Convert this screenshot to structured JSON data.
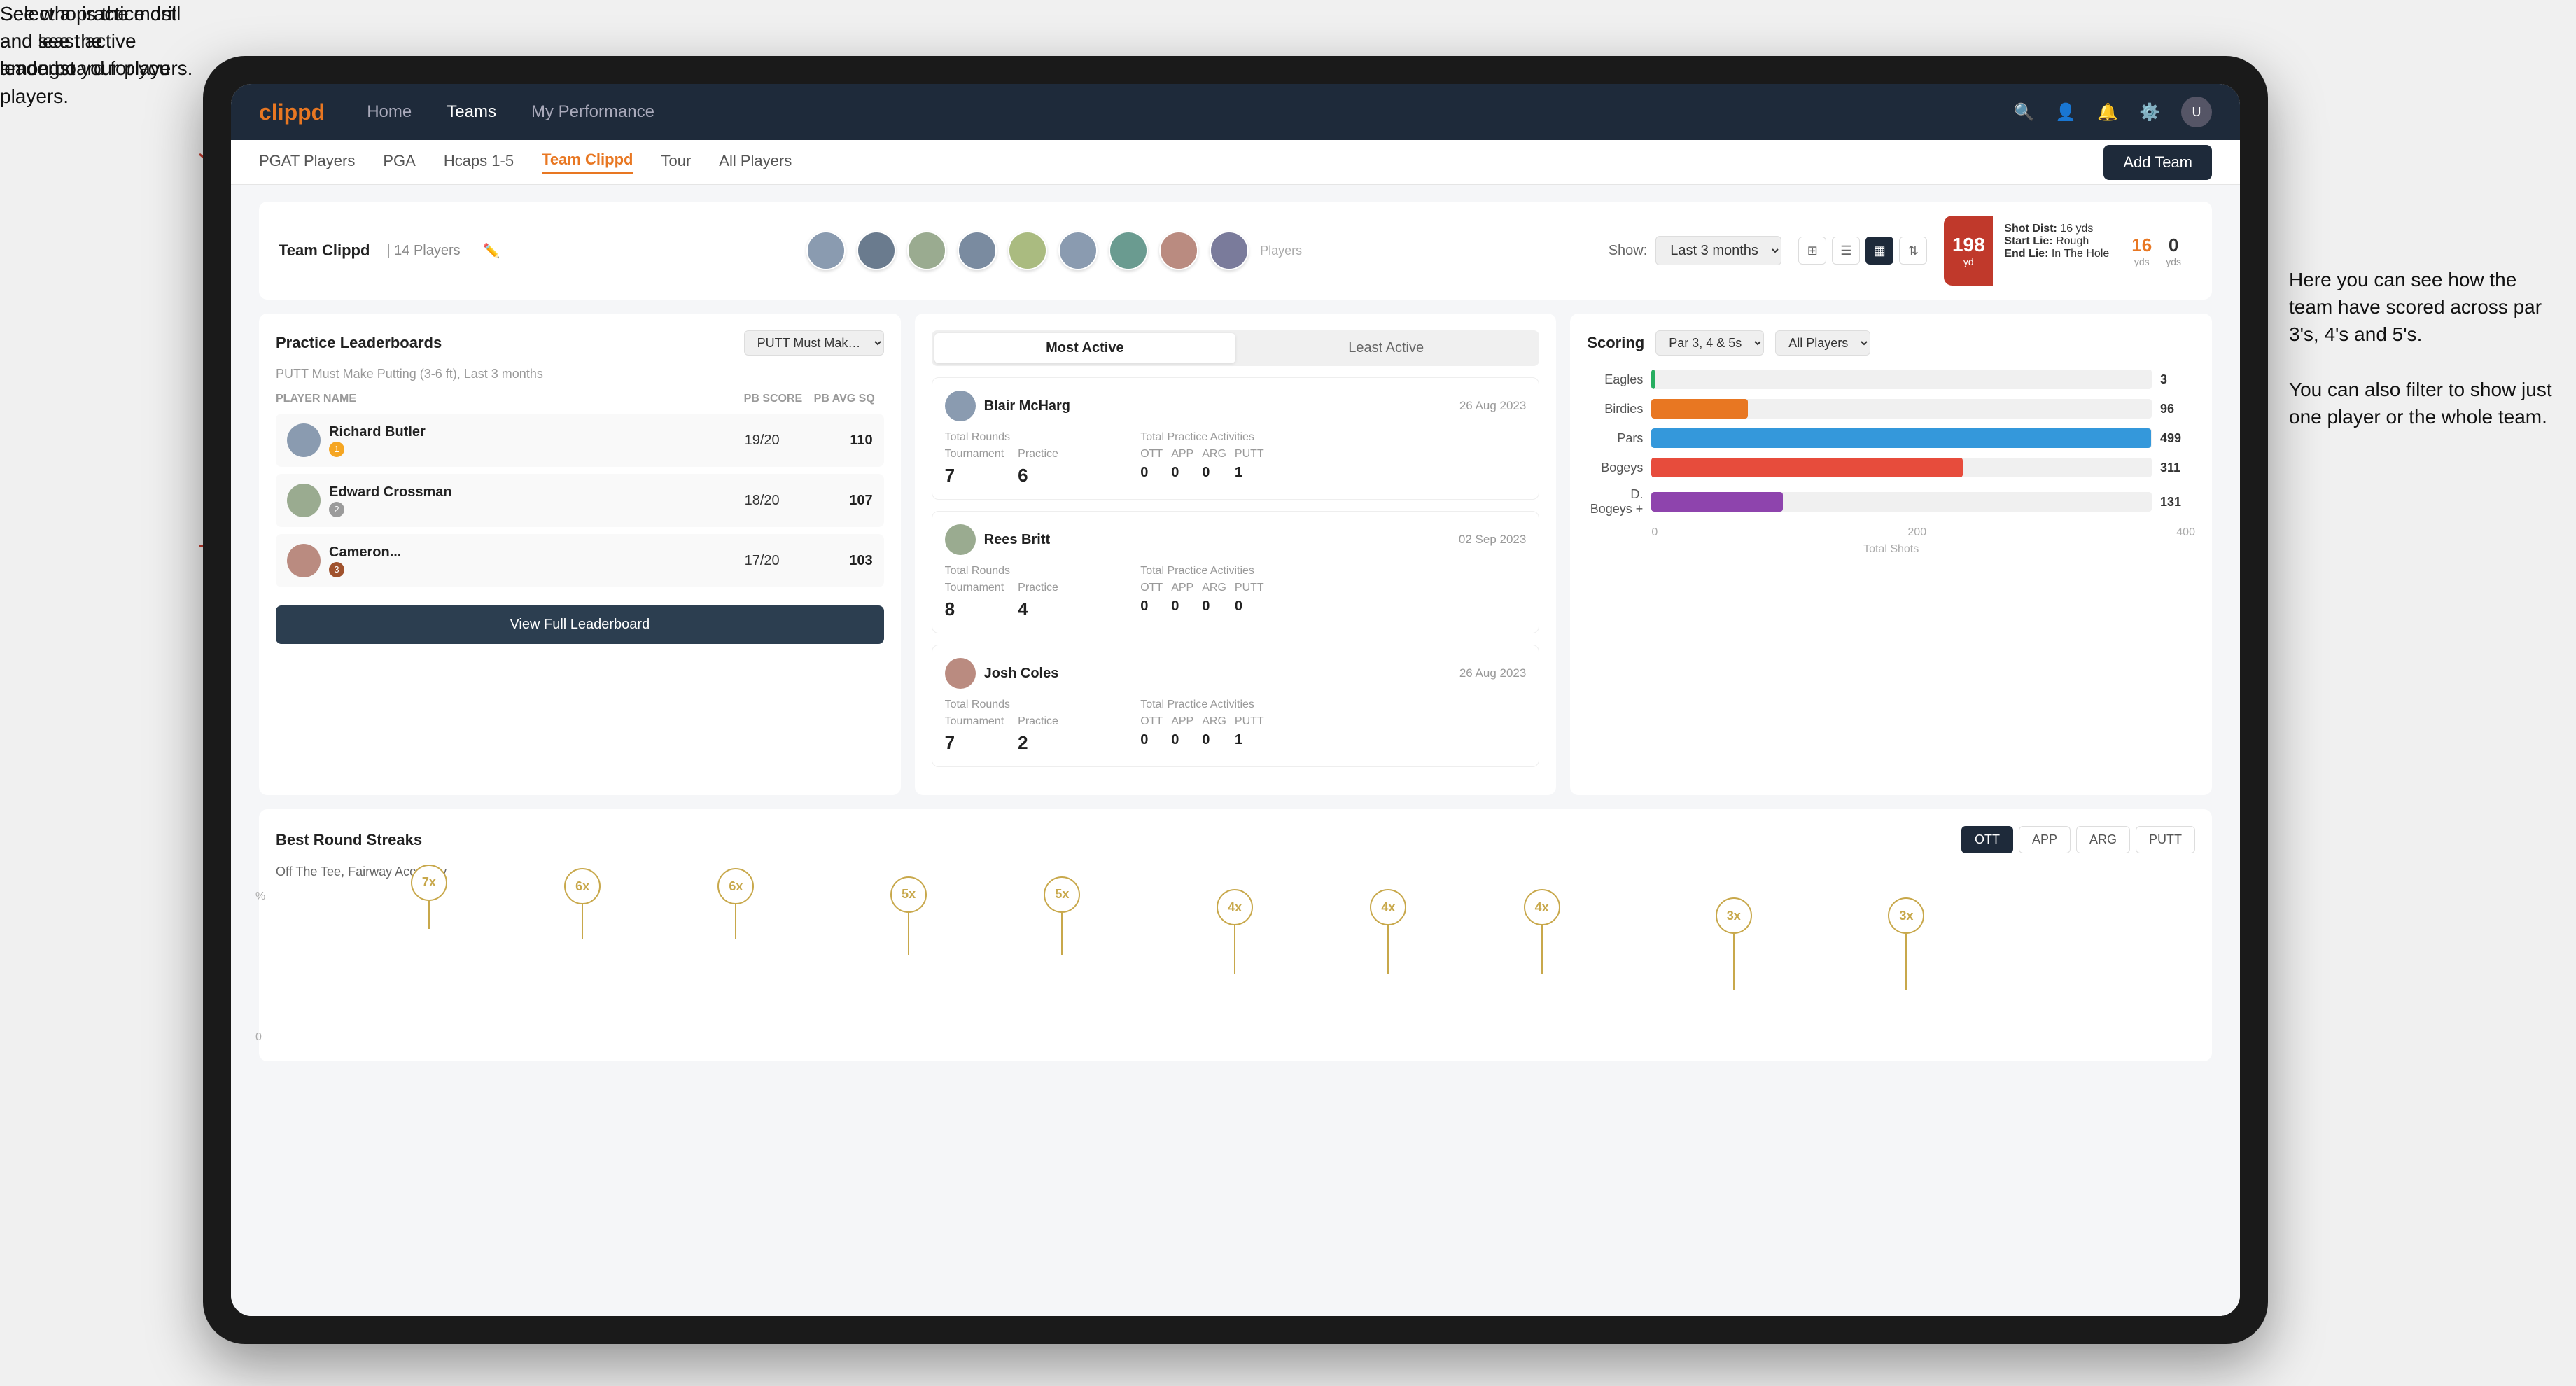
{
  "annotations": {
    "top_left": "Select a practice drill and see the leaderboard for you players.",
    "bottom_left": "See who is the most and least active amongst your players.",
    "top_right": "Here you can see how the team have scored across par 3's, 4's and 5's.\n\nYou can also filter to show just one player or the whole team."
  },
  "nav": {
    "logo": "clippd",
    "items": [
      "Home",
      "Teams",
      "My Performance"
    ],
    "icons": [
      "🔍",
      "👤",
      "🔔",
      "⚙️"
    ],
    "active": "Teams"
  },
  "sub_nav": {
    "items": [
      "PGAT Players",
      "PGA",
      "Hcaps 1-5",
      "Team Clippd",
      "Tour",
      "All Players"
    ],
    "active": "Team Clippd",
    "add_team_label": "Add Team"
  },
  "team_header": {
    "title": "Team Clippd",
    "count": "14 Players",
    "show_label": "Show:",
    "show_value": "Last 3 months",
    "players_label": "Players"
  },
  "shot_card": {
    "number": "198",
    "unit": "yd",
    "shot_dist_label": "Shot Dist:",
    "shot_dist_val": "16 yds",
    "start_lie_label": "Start Lie:",
    "start_lie_val": "Rough",
    "end_lie_label": "End Lie:",
    "end_lie_val": "In The Hole",
    "yds_16": "16",
    "yds_0": "0"
  },
  "practice_leaderboards": {
    "title": "Practice Leaderboards",
    "drill_select": "PUTT Must Make Putting...",
    "subtitle": "PUTT Must Make Putting (3-6 ft),",
    "period": "Last 3 months",
    "col_player": "PLAYER NAME",
    "col_score": "PB SCORE",
    "col_avg": "PB AVG SQ",
    "players": [
      {
        "name": "Richard Butler",
        "score": "19/20",
        "avg": "110",
        "medal": "gold",
        "rank": 1
      },
      {
        "name": "Edward Crossman",
        "score": "18/20",
        "avg": "107",
        "medal": "silver",
        "rank": 2
      },
      {
        "name": "Cameron...",
        "score": "17/20",
        "avg": "103",
        "medal": "bronze",
        "rank": 3
      }
    ],
    "view_full_label": "View Full Leaderboard"
  },
  "most_active": {
    "tab_active": "Most Active",
    "tab_least": "Least Active",
    "players": [
      {
        "name": "Blair McHarg",
        "date": "26 Aug 2023",
        "total_rounds_label": "Total Rounds",
        "tournament_label": "Tournament",
        "practice_label": "Practice",
        "tournament_val": "7",
        "practice_val": "6",
        "total_practice_label": "Total Practice Activities",
        "ott_label": "OTT",
        "app_label": "APP",
        "arg_label": "ARG",
        "putt_label": "PUTT",
        "ott_val": "0",
        "app_val": "0",
        "arg_val": "0",
        "putt_val": "1"
      },
      {
        "name": "Rees Britt",
        "date": "02 Sep 2023",
        "tournament_val": "8",
        "practice_val": "4",
        "ott_val": "0",
        "app_val": "0",
        "arg_val": "0",
        "putt_val": "0"
      },
      {
        "name": "Josh Coles",
        "date": "26 Aug 2023",
        "tournament_val": "7",
        "practice_val": "2",
        "ott_val": "0",
        "app_val": "0",
        "arg_val": "0",
        "putt_val": "1"
      }
    ]
  },
  "scoring": {
    "title": "Scoring",
    "filter1": "Par 3, 4 & 5s",
    "filter2": "All Players",
    "bars": [
      {
        "label": "Eagles",
        "value": 3,
        "max": 500,
        "class": "bar-eagles"
      },
      {
        "label": "Birdies",
        "value": 96,
        "max": 500,
        "class": "bar-birdies"
      },
      {
        "label": "Pars",
        "value": 499,
        "max": 500,
        "class": "bar-pars"
      },
      {
        "label": "Bogeys",
        "value": 311,
        "max": 500,
        "class": "bar-bogeys"
      },
      {
        "label": "D. Bogeys +",
        "value": 131,
        "max": 500,
        "class": "bar-dbogeys"
      }
    ],
    "x_labels": [
      "0",
      "200",
      "400"
    ],
    "total_shots_label": "Total Shots"
  },
  "streaks": {
    "title": "Best Round Streaks",
    "subtitle": "Off The Tee, Fairway Accuracy",
    "filters": [
      "OTT",
      "APP",
      "ARG",
      "PUTT"
    ],
    "active_filter": "OTT",
    "points": [
      {
        "label": "7x",
        "x": 8,
        "y": 20
      },
      {
        "label": "6x",
        "x": 16,
        "y": 30
      },
      {
        "label": "6x",
        "x": 24,
        "y": 30
      },
      {
        "label": "5x",
        "x": 33,
        "y": 40
      },
      {
        "label": "5x",
        "x": 41,
        "y": 40
      },
      {
        "label": "4x",
        "x": 51,
        "y": 55
      },
      {
        "label": "4x",
        "x": 59,
        "y": 55
      },
      {
        "label": "4x",
        "x": 67,
        "y": 55
      },
      {
        "label": "3x",
        "x": 77,
        "y": 65
      },
      {
        "label": "3x",
        "x": 85,
        "y": 65
      }
    ]
  },
  "all_players_label": "All Players"
}
